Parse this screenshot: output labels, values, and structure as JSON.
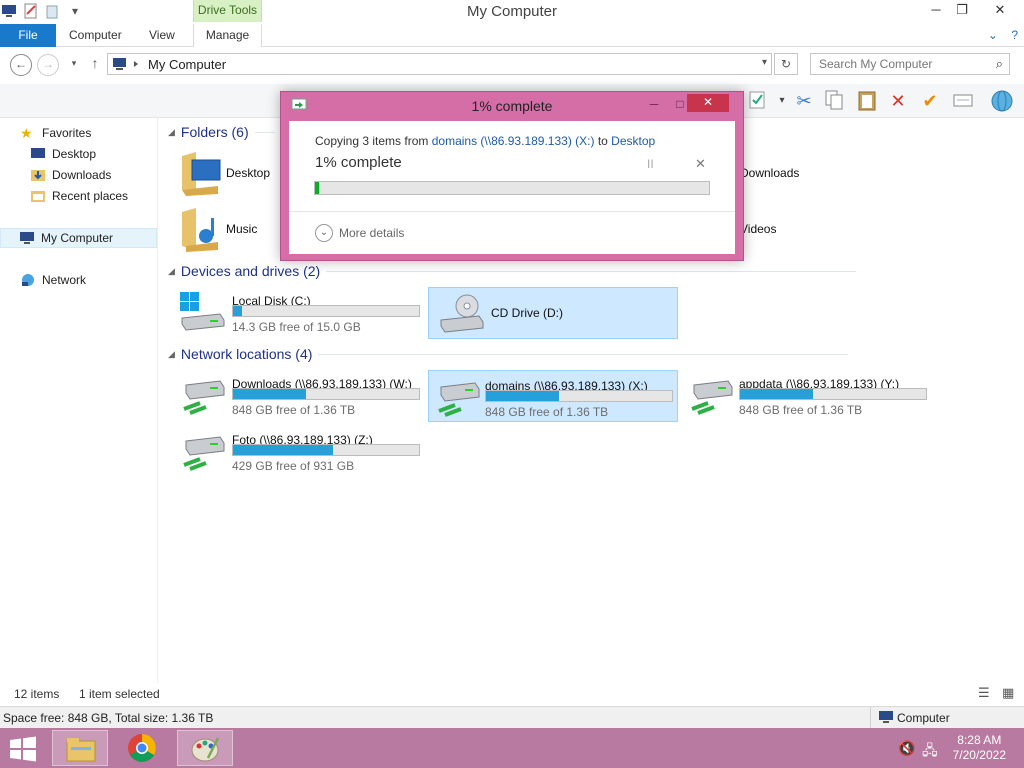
{
  "window": {
    "title": "My Computer",
    "context_tab_group": "Drive Tools",
    "minimize": "─",
    "maximize": "❐",
    "close": "✕"
  },
  "ribbon": {
    "tabs": [
      {
        "label": "File"
      },
      {
        "label": "Computer"
      },
      {
        "label": "View"
      },
      {
        "label": "Manage"
      }
    ],
    "expand": "⌄",
    "help": "?"
  },
  "address": {
    "path": "My Computer",
    "search_placeholder": "Search My Computer"
  },
  "nav_pane": {
    "favorites": "Favorites",
    "items": [
      "Desktop",
      "Downloads",
      "Recent places"
    ],
    "computer": "My Computer",
    "network": "Network"
  },
  "groups": {
    "folders": "Folders (6)",
    "devices": "Devices and drives (2)",
    "network": "Network locations (4)"
  },
  "folders": [
    {
      "name": "Desktop"
    },
    {
      "name": "Downloads"
    },
    {
      "name": "Music"
    },
    {
      "name": "Videos"
    }
  ],
  "drives": [
    {
      "label": "Local Disk (C:)",
      "free": "14.3 GB free of 15.0 GB",
      "used_fraction": 0.05
    },
    {
      "label": "CD Drive (D:)"
    }
  ],
  "network_locations": [
    {
      "label": "Downloads (\\\\86.93.189.133) (W:)",
      "free": "848 GB free of 1.36 TB",
      "used_fraction": 0.39
    },
    {
      "label": "domains (\\\\86.93.189.133) (X:)",
      "free": "848 GB free of 1.36 TB",
      "used_fraction": 0.39
    },
    {
      "label": "appdata (\\\\86.93.189.133) (Y:)",
      "free": "848 GB free of 1.36 TB",
      "used_fraction": 0.39
    },
    {
      "label": "Foto (\\\\86.93.189.133) (Z:)",
      "free": "429 GB free of 931 GB",
      "used_fraction": 0.54
    }
  ],
  "dialog": {
    "title": "1% complete",
    "copy_prefix": "Copying 3 items from ",
    "source": "domains (\\\\86.93.189.133) (X:)",
    "to_word": " to ",
    "destination": "Desktop",
    "percent_text": "1% complete",
    "progress_fraction": 0.01,
    "more_details": "More details",
    "pause": "II",
    "cancel": "✕",
    "minimize": "─",
    "maximize": "□",
    "close": "✕"
  },
  "status": {
    "items": "12 items",
    "selected": "1 item selected",
    "space": "Space free: 848 GB, Total size: 1.36 TB",
    "location": "Computer"
  },
  "taskbar": {
    "time": "8:28 AM",
    "date": "7/20/2022"
  }
}
